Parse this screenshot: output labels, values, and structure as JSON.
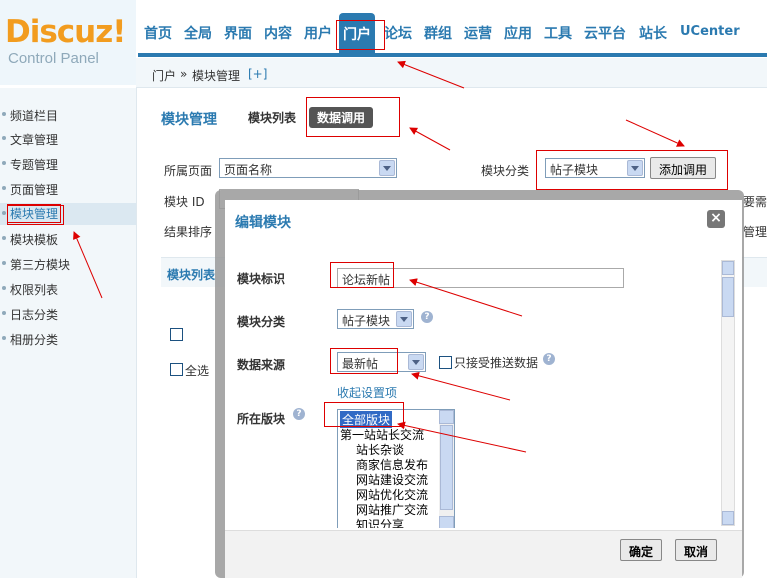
{
  "logo": {
    "brand": "Discuz!",
    "subtitle": "Control Panel"
  },
  "nav": {
    "items": [
      "首页",
      "全局",
      "界面",
      "内容",
      "用户",
      "门户",
      "论坛",
      "群组",
      "运营",
      "应用",
      "工具",
      "云平台",
      "站长",
      "UCenter"
    ],
    "active_index": 5
  },
  "breadcrumb": {
    "section": "门户",
    "separator": "»",
    "page": "模块管理",
    "add": "[+]"
  },
  "sidebar": {
    "items": [
      "频道栏目",
      "文章管理",
      "专题管理",
      "页面管理",
      "模块管理",
      "模块模板",
      "第三方模块",
      "权限列表",
      "日志分类",
      "相册分类"
    ],
    "active_index": 4
  },
  "main": {
    "title": "模块管理",
    "tabs": [
      "模块列表",
      "数据调用"
    ],
    "active_tab_index": 1,
    "filters": {
      "page_label": "所属页面",
      "page_value": "页面名称",
      "category_label": "模块分类",
      "category_value": "帖子模块",
      "add_button": "添加调用",
      "module_id_label": "模块 ID",
      "sort_label": "结果排序",
      "cut_right_1": "要需",
      "cut_right_2": "管理"
    },
    "list_header": "模块列表",
    "select_all": "全选"
  },
  "modal": {
    "title": "编辑模块",
    "close": "×",
    "fields": {
      "module_name_label": "模块标识",
      "module_name_value": "论坛新帖",
      "module_category_label": "模块分类",
      "module_category_value": "帖子模块",
      "data_source_label": "数据来源",
      "data_source_value": "最新帖",
      "push_only_label": "只接受推送数据",
      "collapse_link": "收起设置项",
      "forum_label": "所在版块",
      "forum_options": [
        "全部版块",
        "第一站站长交流",
        "站长杂谈",
        "商家信息发布",
        "网站建设交流",
        "网站优化交流",
        "网站推广交流",
        "知识分享"
      ]
    },
    "buttons": {
      "ok": "确定",
      "cancel": "取消"
    }
  },
  "colors": {
    "accent": "#2b7ab0",
    "logo_orange": "#f29c1f",
    "annotation_red": "#dd0000"
  }
}
